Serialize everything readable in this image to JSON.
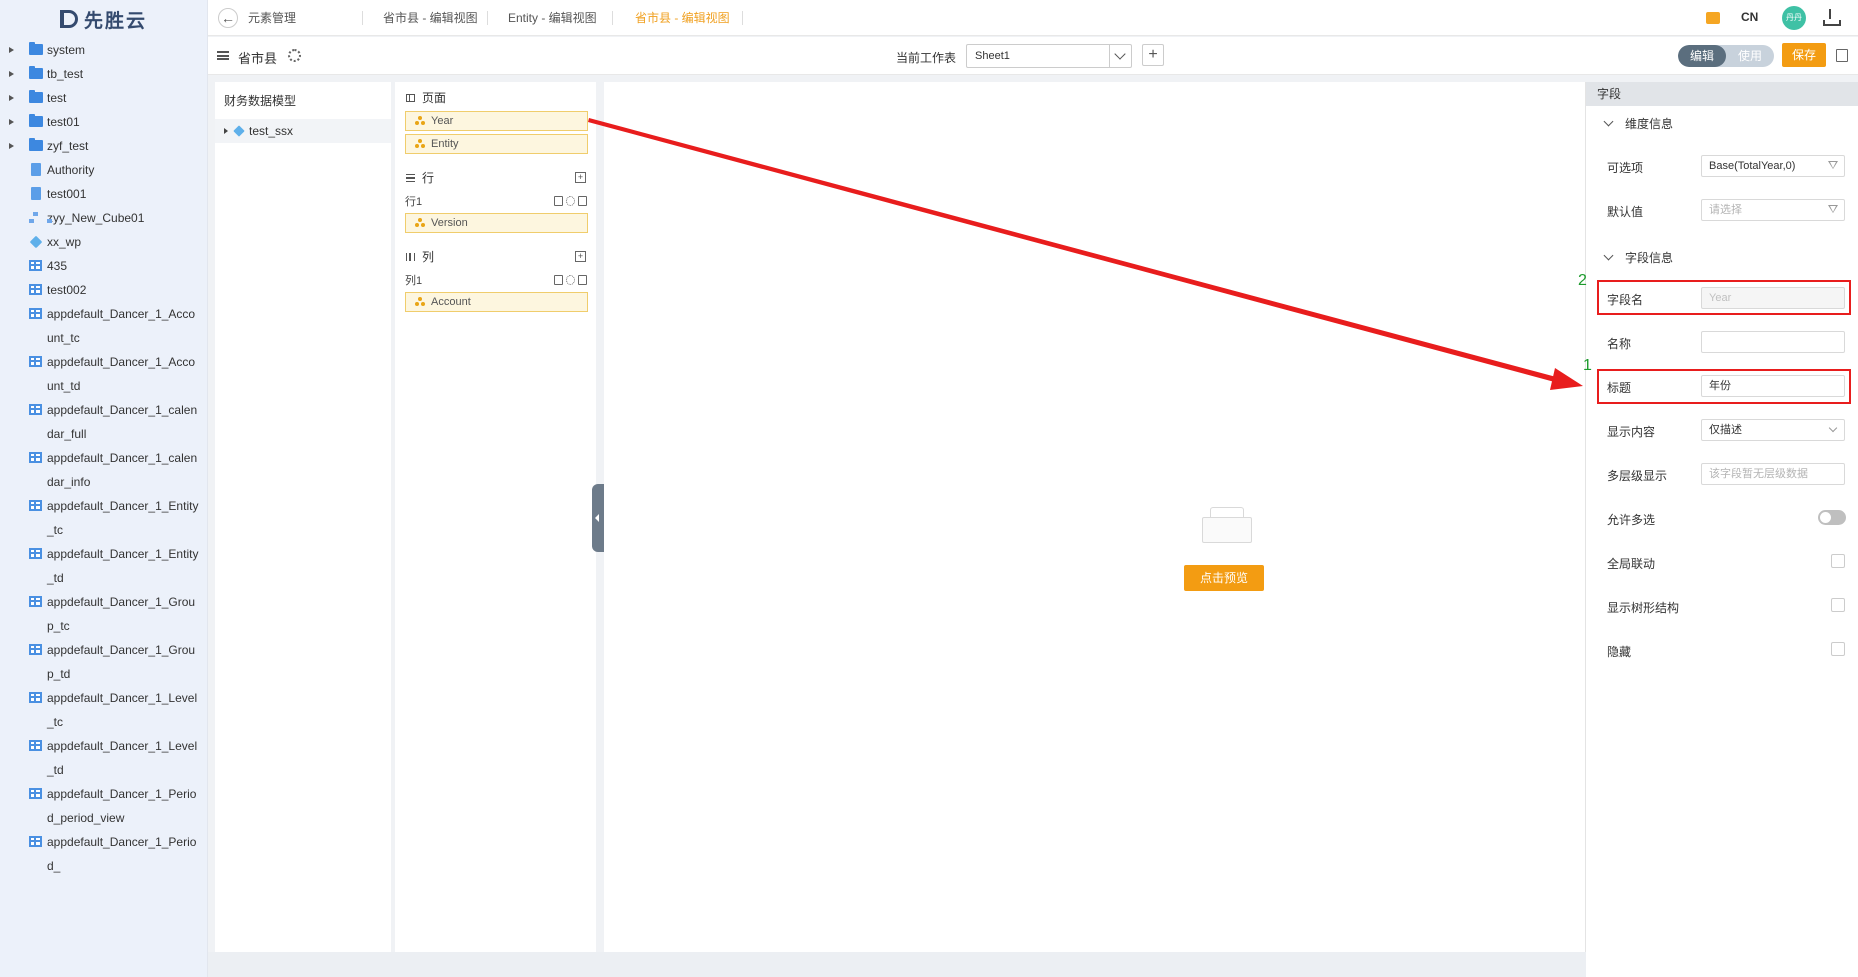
{
  "app": {
    "logo_text": "先胜云"
  },
  "sidebar": {
    "items": [
      {
        "label": "system",
        "icon": "folder-icon",
        "expandable": true
      },
      {
        "label": "tb_test",
        "icon": "folder-icon",
        "expandable": true
      },
      {
        "label": "test",
        "icon": "folder-icon",
        "expandable": true
      },
      {
        "label": "test01",
        "icon": "folder-icon",
        "expandable": true
      },
      {
        "label": "zyf_test",
        "icon": "folder-icon",
        "expandable": true
      },
      {
        "label": "Authority",
        "icon": "document-icon",
        "expandable": false
      },
      {
        "label": "test001",
        "icon": "document-icon",
        "expandable": false
      },
      {
        "label": "zyy_New_Cube01",
        "icon": "hierarchy-icon",
        "expandable": false
      },
      {
        "label": "xx_wp",
        "icon": "cube-icon",
        "expandable": false
      },
      {
        "label": "435",
        "icon": "table-icon",
        "expandable": false
      },
      {
        "label": "test002",
        "icon": "table-icon",
        "expandable": false
      },
      {
        "label": "appdefault_Dancer_1_Account_tc",
        "icon": "table-icon",
        "expandable": false
      },
      {
        "label": "appdefault_Dancer_1_Account_td",
        "icon": "table-icon",
        "expandable": false
      },
      {
        "label": "appdefault_Dancer_1_calendar_full",
        "icon": "table-icon",
        "expandable": false
      },
      {
        "label": "appdefault_Dancer_1_calendar_info",
        "icon": "table-icon",
        "expandable": false
      },
      {
        "label": "appdefault_Dancer_1_Entity_tc",
        "icon": "table-icon",
        "expandable": false
      },
      {
        "label": "appdefault_Dancer_1_Entity_td",
        "icon": "table-icon",
        "expandable": false
      },
      {
        "label": "appdefault_Dancer_1_Group_tc",
        "icon": "table-icon",
        "expandable": false
      },
      {
        "label": "appdefault_Dancer_1_Group_td",
        "icon": "table-icon",
        "expandable": false
      },
      {
        "label": "appdefault_Dancer_1_Level_tc",
        "icon": "table-icon",
        "expandable": false
      },
      {
        "label": "appdefault_Dancer_1_Level_td",
        "icon": "table-icon",
        "expandable": false
      },
      {
        "label": "appdefault_Dancer_1_Period_period_view",
        "icon": "table-icon",
        "expandable": false
      },
      {
        "label": "appdefault_Dancer_1_Period_",
        "icon": "table-icon",
        "expandable": false
      }
    ]
  },
  "topbar": {
    "tabs": [
      {
        "label": "元素管理",
        "active": false
      },
      {
        "label": "省市县 - 编辑视图",
        "active": false
      },
      {
        "label": "Entity - 编辑视图",
        "active": false
      },
      {
        "label": "省市县 - 编辑视图",
        "active": true
      }
    ],
    "lang": "CN",
    "avatar_text": "丹丹"
  },
  "toolbar": {
    "model_name": "省市县",
    "sheet_label": "当前工作表",
    "sheet_value": "Sheet1",
    "add_sheet": "+",
    "mode_edit": "编辑",
    "mode_use": "使用",
    "save_label": "保存"
  },
  "model_panel": {
    "title": "财务数据模型",
    "item": "test_ssx"
  },
  "dims_panel": {
    "page": {
      "title": "页面",
      "chips": [
        "Year",
        "Entity"
      ]
    },
    "rows": {
      "title": "行",
      "group": "行1",
      "chips": [
        "Version"
      ]
    },
    "cols": {
      "title": "列",
      "group": "列1",
      "chips": [
        "Account"
      ]
    }
  },
  "canvas": {
    "preview_label": "点击预览"
  },
  "props": {
    "title": "字段",
    "dim_section": "维度信息",
    "field_section": "字段信息",
    "optional_label": "可选项",
    "optional_value": "Base(TotalYear,0)",
    "default_label": "默认值",
    "default_placeholder": "请选择",
    "field_name_label": "字段名",
    "field_name_value": "Year",
    "name_label": "名称",
    "name_value": "",
    "caption_label": "标题",
    "caption_value": "年份",
    "display_label": "显示内容",
    "display_value": "仅描述",
    "multilevel_label": "多层级显示",
    "multilevel_placeholder": "该字段暂无层级数据",
    "multiselect_label": "允许多选",
    "multiselect_on": false,
    "global_link_label": "全局联动",
    "tree_label": "显示树形结构",
    "hidden_label": "隐藏"
  },
  "annotations": {
    "num1": "1",
    "num2": "2"
  },
  "colors": {
    "accent": "#f39c12",
    "highlight": "#e81d1d",
    "annotation_number": "#1c9a2c"
  }
}
